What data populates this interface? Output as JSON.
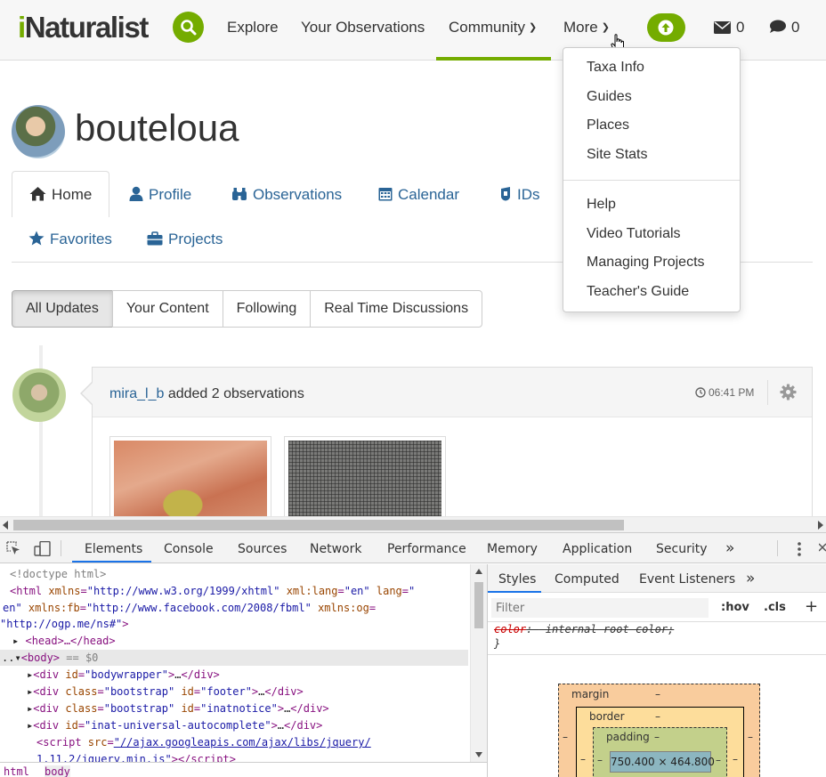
{
  "topnav": {
    "logo": {
      "first": "i",
      "rest": "Naturalist"
    },
    "items": [
      {
        "label": "Explore"
      },
      {
        "label": "Your Observations"
      },
      {
        "label": "Community"
      },
      {
        "label": "More"
      }
    ],
    "messages_count": "0",
    "comments_count": "0",
    "accent_color": "#74ac00"
  },
  "more_menu": {
    "group1": [
      "Taxa Info",
      "Guides",
      "Places",
      "Site Stats"
    ],
    "group2": [
      "Help",
      "Video Tutorials",
      "Managing Projects",
      "Teacher's Guide"
    ]
  },
  "profile": {
    "username": "bouteloua",
    "tabs": [
      {
        "label": "Home",
        "icon": "home-icon"
      },
      {
        "label": "Profile",
        "icon": "user-icon"
      },
      {
        "label": "Observations",
        "icon": "binoculars-icon"
      },
      {
        "label": "Calendar",
        "icon": "calendar-icon"
      },
      {
        "label": "IDs",
        "icon": "ids-icon"
      },
      {
        "label": "Favorites",
        "icon": "star-icon"
      },
      {
        "label": "Projects",
        "icon": "briefcase-icon"
      }
    ]
  },
  "filters": [
    "All Updates",
    "Your Content",
    "Following",
    "Real Time Discussions"
  ],
  "feed": {
    "user": "mira_l_b",
    "action": "added 2 observations",
    "time": "06:41 PM"
  },
  "devtools": {
    "tabs": [
      "Elements",
      "Console",
      "Sources",
      "Network",
      "Performance",
      "Memory",
      "Application",
      "Security"
    ],
    "more_tabs": "»",
    "code": {
      "doctype": "<!doctype html>",
      "html_open_tag": "<html",
      "html_attr1": "xmlns",
      "html_val1": "\"http://www.w3.org/1999/xhtml\"",
      "html_attr2": "xml:lang",
      "html_val2": "\"en\"",
      "html_attr3": "lang",
      "html_val3a": "\"",
      "html_val3b": "en\"",
      "html_attr4": "xmlns:fb",
      "html_val4": "\"http://www.facebook.com/2008/fbml\"",
      "html_attr5": "xmlns:og",
      "html_val5": "\"http://ogp.me/ns#\"",
      "head": "<head>…</head>",
      "body_prefix": "..",
      "body_tag": "<body>",
      "body_eq": "== $0",
      "div1_id": "\"bodywrapper\"",
      "div2_class": "\"bootstrap\"",
      "div2_id": "\"footer\"",
      "div3_class": "\"bootstrap\"",
      "div3_id": "\"inatnotice\"",
      "div4_id": "\"inat-universal-autocomplete\"",
      "script_src": "\"//ajax.googleapis.com/ajax/libs/jquery/",
      "script_src2": "1.11.2/jquery.min.js\""
    },
    "breadcrumbs": [
      "html",
      "body"
    ],
    "side_tabs": [
      "Styles",
      "Computed",
      "Event Listeners"
    ],
    "filter_placeholder": "Filter",
    "hov": ":hov",
    "cls": ".cls",
    "rule_prop": "color",
    "rule_val": "-internal-root-color;",
    "rule_close": "}",
    "box_model": {
      "margin_label": "margin",
      "border_label": "border",
      "padding_label": "padding",
      "dash": "–",
      "content": "750.400 × 464.800"
    }
  }
}
